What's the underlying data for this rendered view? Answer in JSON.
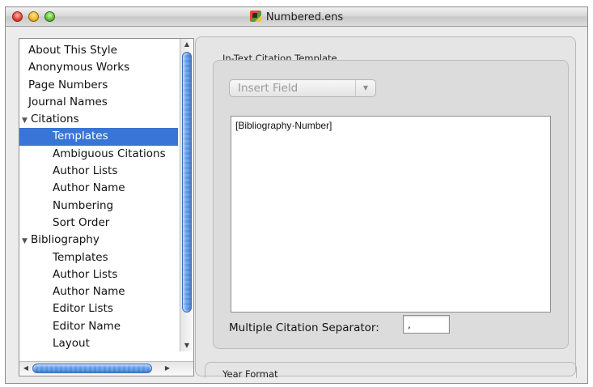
{
  "window": {
    "title": "Numbered.ens"
  },
  "sidebar": {
    "items": [
      {
        "label": "About This Style",
        "level": 0
      },
      {
        "label": "Anonymous Works",
        "level": 0
      },
      {
        "label": "Page Numbers",
        "level": 0
      },
      {
        "label": "Journal Names",
        "level": 0
      },
      {
        "label": "Citations",
        "level": 0,
        "expanded": true,
        "disclosure": "▼"
      },
      {
        "label": "Templates",
        "level": 1,
        "selected": true
      },
      {
        "label": "Ambiguous Citations",
        "level": 1
      },
      {
        "label": "Author Lists",
        "level": 1
      },
      {
        "label": "Author Name",
        "level": 1
      },
      {
        "label": "Numbering",
        "level": 1
      },
      {
        "label": "Sort Order",
        "level": 1
      },
      {
        "label": "Bibliography",
        "level": 0,
        "expanded": true,
        "disclosure": "▼"
      },
      {
        "label": "Templates",
        "level": 1
      },
      {
        "label": "Author Lists",
        "level": 1
      },
      {
        "label": "Author Name",
        "level": 1
      },
      {
        "label": "Editor Lists",
        "level": 1
      },
      {
        "label": "Editor Name",
        "level": 1
      },
      {
        "label": "Layout",
        "level": 1
      }
    ]
  },
  "main": {
    "section_title": "In-Text Citation Template",
    "insert_field_label": "Insert Field",
    "template_text": "[Bibliography·Number]",
    "separator_label": "Multiple Citation Separator:",
    "separator_value": ",",
    "next_section_title": "Year Format"
  },
  "colors": {
    "selection": "#3875d7",
    "scroll_thumb": "#5b97e6"
  }
}
